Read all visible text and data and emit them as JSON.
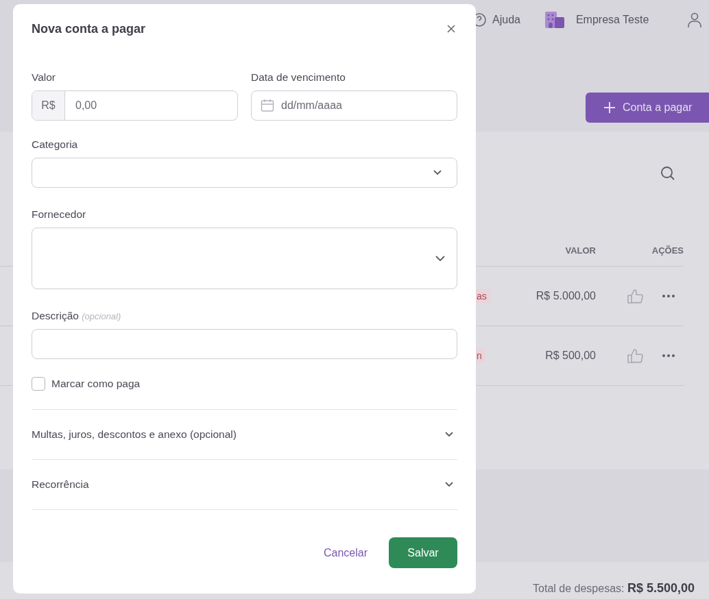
{
  "header": {
    "help": "Ajuda",
    "company": "Empresa Teste"
  },
  "new_button": "Conta a pagar",
  "table": {
    "columns": [
      "VALOR",
      "AÇÕES"
    ],
    "rows": [
      {
        "badge": "as",
        "value": "R$ 5.000,00"
      },
      {
        "badge": "n",
        "value": "R$ 500,00"
      }
    ]
  },
  "footer": {
    "label": "Total de despesas:",
    "total": "R$ 5.500,00"
  },
  "modal": {
    "title": "Nova conta a pagar",
    "valor": {
      "label": "Valor",
      "prefix": "R$",
      "placeholder": "0,00"
    },
    "date": {
      "label": "Data de vencimento",
      "placeholder": "dd/mm/aaaa"
    },
    "category": {
      "label": "Categoria"
    },
    "supplier": {
      "label": "Fornecedor"
    },
    "description": {
      "label": "Descrição",
      "hint": "(opcional)"
    },
    "paid": {
      "label": "Marcar como paga",
      "checked": false
    },
    "sections": [
      {
        "label": "Multas, juros, descontos e anexo (opcional)",
        "expanded": false
      },
      {
        "label": "Recorrência",
        "expanded": false
      }
    ],
    "cancel": "Cancelar",
    "save": "Salvar"
  }
}
